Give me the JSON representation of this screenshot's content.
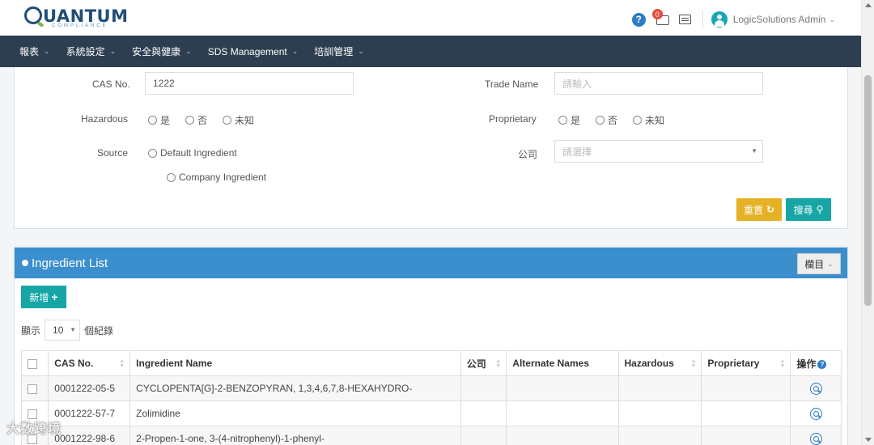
{
  "header": {
    "logo_text": "UANTUM",
    "logo_sub": "COMPLIANCE",
    "notification_count": "0",
    "user_name": "LogicSolutions Admin"
  },
  "nav": {
    "items": [
      {
        "label": "報表"
      },
      {
        "label": "系統設定"
      },
      {
        "label": "安全與健康"
      },
      {
        "label": "SDS Management"
      },
      {
        "label": "培訓管理"
      }
    ]
  },
  "search": {
    "cas_label": "CAS No.",
    "cas_value": "1222",
    "trade_name_label": "Trade Name",
    "trade_name_placeholder": "請輸入",
    "hazardous_label": "Hazardous",
    "hazardous_options": [
      "是",
      "否",
      "未知"
    ],
    "proprietary_label": "Proprietary",
    "proprietary_options": [
      "是",
      "否",
      "未知"
    ],
    "source_label": "Source",
    "source_options": [
      "Default Ingredient",
      "Company Ingredient"
    ],
    "company_label": "公司",
    "company_placeholder": "請選擇",
    "reset_label": "重置",
    "search_label": "搜尋"
  },
  "list": {
    "title": "Ingredient List",
    "columns_button": "欄目",
    "add_label": "新增",
    "show_label": "顯示",
    "page_size": "10",
    "records_label": "個紀錄",
    "headers": [
      "CAS No.",
      "Ingredient Name",
      "公司",
      "Alternate Names",
      "Hazardous",
      "Proprietary",
      "操作"
    ],
    "rows": [
      {
        "cas": "0001222-05-5",
        "name": "CYCLOPENTA[G]-2-BENZOPYRAN, 1,3,4,6,7,8-HEXAHYDRO-",
        "company": "",
        "alt": "",
        "hazardous": "",
        "proprietary": ""
      },
      {
        "cas": "0001222-57-7",
        "name": "Zolimidine",
        "company": "",
        "alt": "",
        "hazardous": "",
        "proprietary": ""
      },
      {
        "cas": "0001222-98-6",
        "name": "2-Propen-1-one, 3-(4-nitrophenyl)-1-phenyl-",
        "company": "",
        "alt": "",
        "hazardous": "",
        "proprietary": ""
      }
    ]
  },
  "watermark": "大数跨境"
}
